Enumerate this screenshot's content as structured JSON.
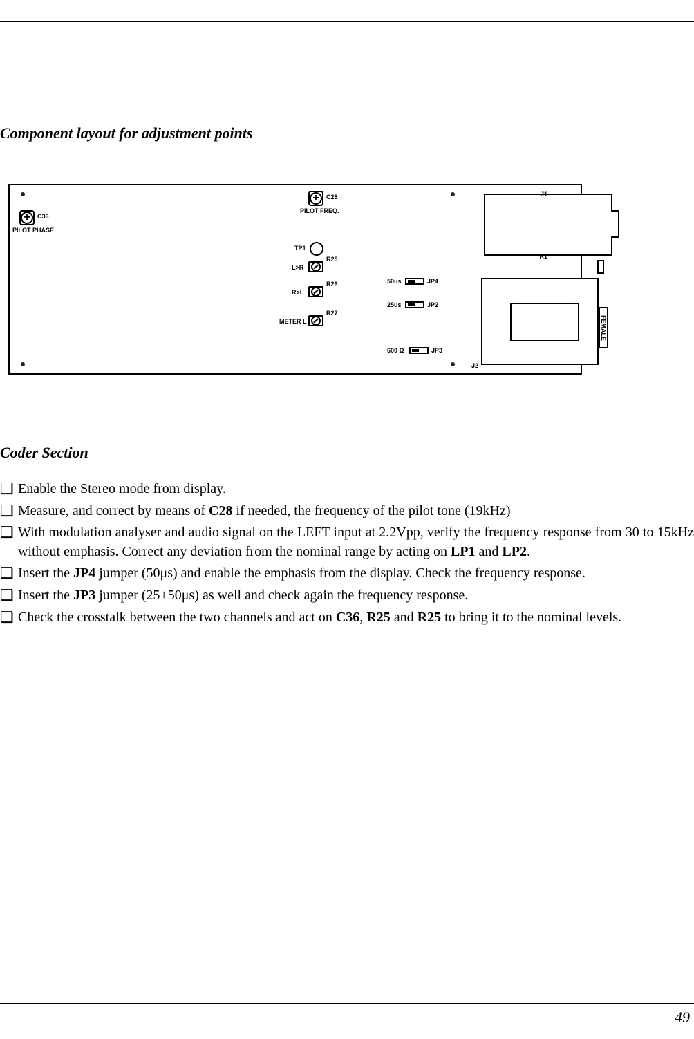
{
  "headings": {
    "h1": "Component layout for adjustment points",
    "h2": "Coder Section"
  },
  "diagram": {
    "c36": {
      "label": "C36",
      "sub": "PILOT PHASE"
    },
    "c28": {
      "label": "C28",
      "sub": "PILOT FREQ."
    },
    "tp1": "TP1",
    "pots": [
      {
        "left": "L>R",
        "right": "R25"
      },
      {
        "left": "R>L",
        "right": "R26"
      },
      {
        "left": "METER L",
        "right": "R27"
      }
    ],
    "jumpers": [
      {
        "left": "50us",
        "right": "JP4"
      },
      {
        "left": "25us",
        "right": "JP2"
      },
      {
        "left": "600 Ω",
        "right": "JP3"
      }
    ],
    "j1": "J1",
    "r1": "R1",
    "j2": "J2",
    "female": "FEMALE"
  },
  "checklist": [
    "Enable the Stereo mode from display.",
    "Measure, and correct by means of <b>C28</b> if needed, the frequency of the pilot tone (19kHz)",
    "With modulation analyser and audio signal on the LEFT input at 2.2Vpp, verify the frequency response from 30 to 15kHz without emphasis. Correct any deviation from the nominal range by acting on <b>LP1</b> and <b>LP2</b>.",
    "Insert the <b>JP4</b> jumper (50μs) and enable the emphasis from the display. Check the frequency response.",
    "Insert the <b>JP3</b> jumper (25+50μs) as well and check again the frequency response.",
    "Check the crosstalk between the two channels and act on <b>C36</b>, <b>R25</b> and <b>R25</b> to bring it to the nominal levels."
  ],
  "page": "49"
}
